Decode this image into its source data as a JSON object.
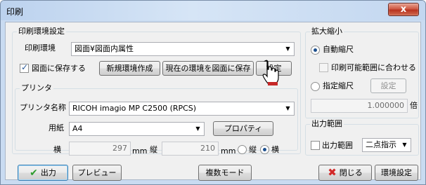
{
  "window": {
    "title": "印刷",
    "close_glyph": "x"
  },
  "env_group": {
    "legend": "印刷環境設定",
    "env_label": "印刷環境",
    "env_value": "図面¥図面内属性",
    "save_to_drawing_label": "図面に保存する",
    "save_to_drawing_checked": true,
    "new_env_button": "新規環境作成",
    "save_current_button": "現在の環境を図面に保存",
    "settings_button": "設定"
  },
  "printer_group": {
    "legend": "プリンタ",
    "printer_name_label": "プリンタ名称",
    "printer_name_value": "RICOH imagio MP C2500 (RPCS)",
    "paper_label": "用紙",
    "paper_value": "A4",
    "properties_button": "プロパティ",
    "width_label": "横",
    "width_value": "297",
    "width_unit": "mm",
    "height_label": "縦",
    "height_value": "210",
    "height_unit": "mm",
    "orientation_portrait": "縦",
    "orientation_landscape": "横",
    "orientation_selected": "横"
  },
  "scale_group": {
    "legend": "拡大縮小",
    "auto_scale_label": "自動縮尺",
    "fit_printable_label": "印刷可能範囲に合わせる",
    "specified_scale_label": "指定縮尺",
    "specified_settings_button": "設定",
    "scale_value": "1.000000",
    "scale_unit": "倍",
    "selected": "自動縮尺"
  },
  "output_group": {
    "legend": "出力範囲",
    "output_range_label": "出力範囲",
    "output_range_value": "二点指示"
  },
  "footer": {
    "output_button": "出力",
    "preview_button": "プレビュー",
    "multi_mode_button": "複数モード",
    "close_button": "閉じる",
    "env_settings_button": "環境設定"
  }
}
